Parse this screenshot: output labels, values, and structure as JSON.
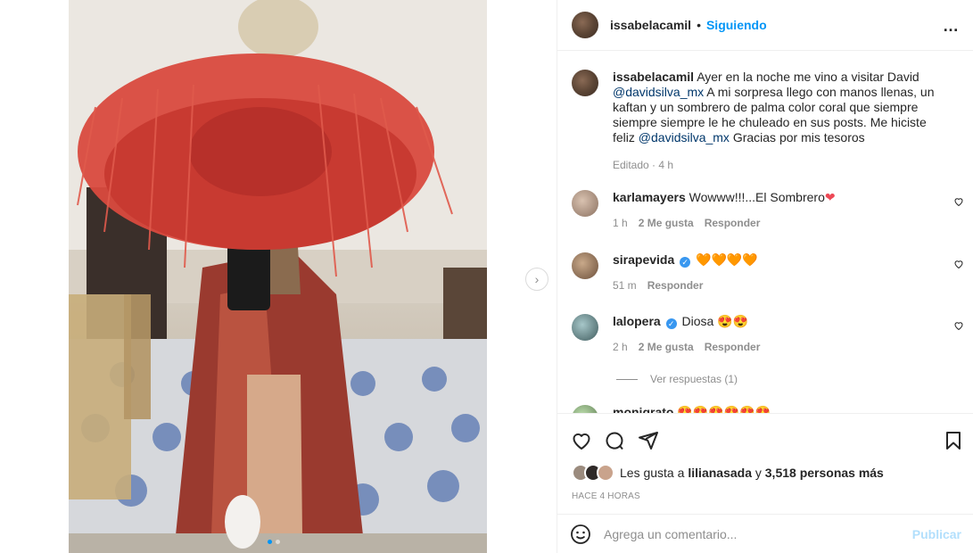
{
  "post": {
    "author": "issabelacamil",
    "separator": "•",
    "follow_label": "Siguiendo",
    "more_label": "•••"
  },
  "caption": {
    "author": "issabelacamil",
    "text_1": "Ayer en la noche me vino a visitar David ",
    "mention_1": "@davidsilva_mx",
    "text_2": " A mi sorpresa llego con manos llenas, un kaftan y un sombrero de palma color coral que siempre siempre siempre le he chuleado en sus posts. Me hiciste feliz ",
    "mention_2": "@davidsilva_mx",
    "text_3": " Gracias por mis tesoros",
    "meta": "Editado · 4 h"
  },
  "comments": [
    {
      "user": "karlamayers",
      "text": "Wowww!!!...El Sombrero",
      "emoji": "❤",
      "time": "1 h",
      "likes": "2 Me gusta",
      "reply": "Responder",
      "verified": false
    },
    {
      "user": "sirapevida",
      "text": "",
      "emoji": "🧡🧡🧡🧡",
      "time": "51 m",
      "likes": "",
      "reply": "Responder",
      "verified": true
    },
    {
      "user": "lalopera",
      "text": "Diosa",
      "emoji": "😍😍",
      "time": "2 h",
      "likes": "2 Me gusta",
      "reply": "Responder",
      "verified": true
    },
    {
      "user": "monigrato",
      "text": "",
      "emoji": "😍😍😍😍😍😍"
    }
  ],
  "view_replies": "Ver respuestas (1)",
  "likes": {
    "prefix": "Les gusta a ",
    "user": "lilianasada",
    "middle": " y ",
    "count": "3,518 personas más"
  },
  "timestamp": "HACE 4 HORAS",
  "add_comment": {
    "placeholder": "Agrega un comentario...",
    "publish": "Publicar"
  },
  "icons": [
    "heart-icon",
    "comment-icon",
    "share-icon",
    "bookmark-icon",
    "emoji-icon",
    "chevron-right-icon",
    "more-icon"
  ],
  "colors": {
    "accent": "#0095f6",
    "link": "#00376b",
    "heart_red": "#ed4956",
    "publish_disabled": "#b2dffc"
  }
}
